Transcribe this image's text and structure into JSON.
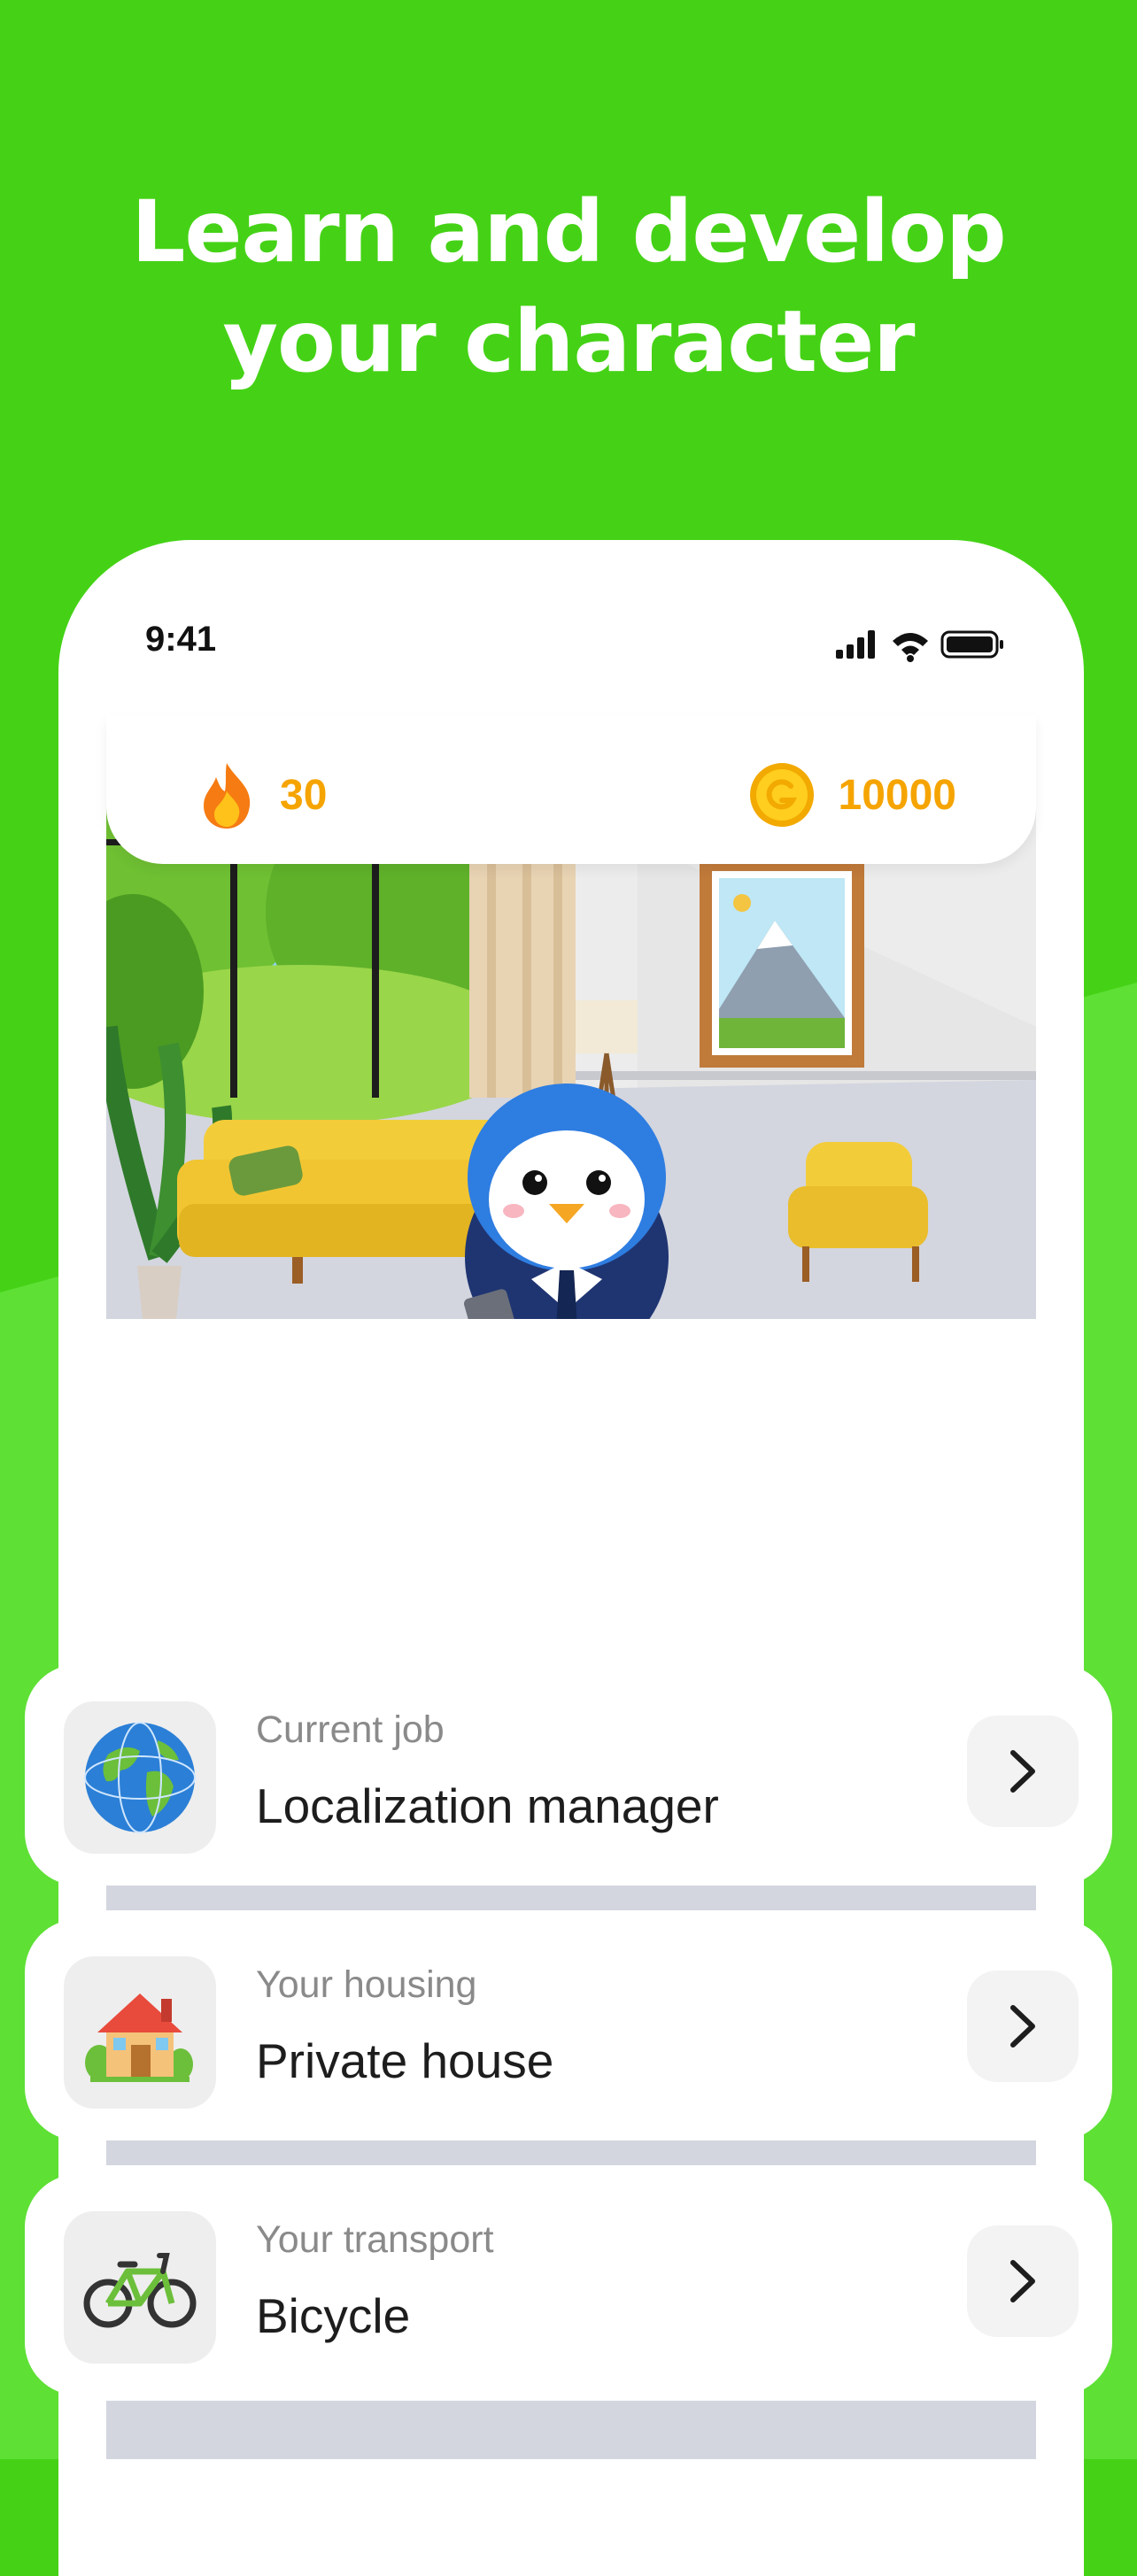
{
  "headline": {
    "line1": "Learn and develop",
    "line2": "your character"
  },
  "status_bar": {
    "time": "9:41",
    "icons": [
      "cellular-signal-icon",
      "wifi-icon",
      "battery-icon"
    ]
  },
  "stats": {
    "streak": {
      "icon": "fire-icon",
      "value": "30"
    },
    "coins": {
      "icon": "coin-icon",
      "value": "10000"
    }
  },
  "scene": {
    "description_icon": "penguin-in-living-room-illustration"
  },
  "cards": [
    {
      "icon": "globe-icon",
      "label": "Current job",
      "value": "Localization manager"
    },
    {
      "icon": "house-icon",
      "label": "Your housing",
      "value": "Private house"
    },
    {
      "icon": "bicycle-icon",
      "label": "Your transport",
      "value": "Bicycle"
    }
  ],
  "colors": {
    "brand_green": "#45d216",
    "accent_orange": "#f5a400",
    "card_bg": "#ffffff",
    "icon_tile": "#eeeeee"
  }
}
